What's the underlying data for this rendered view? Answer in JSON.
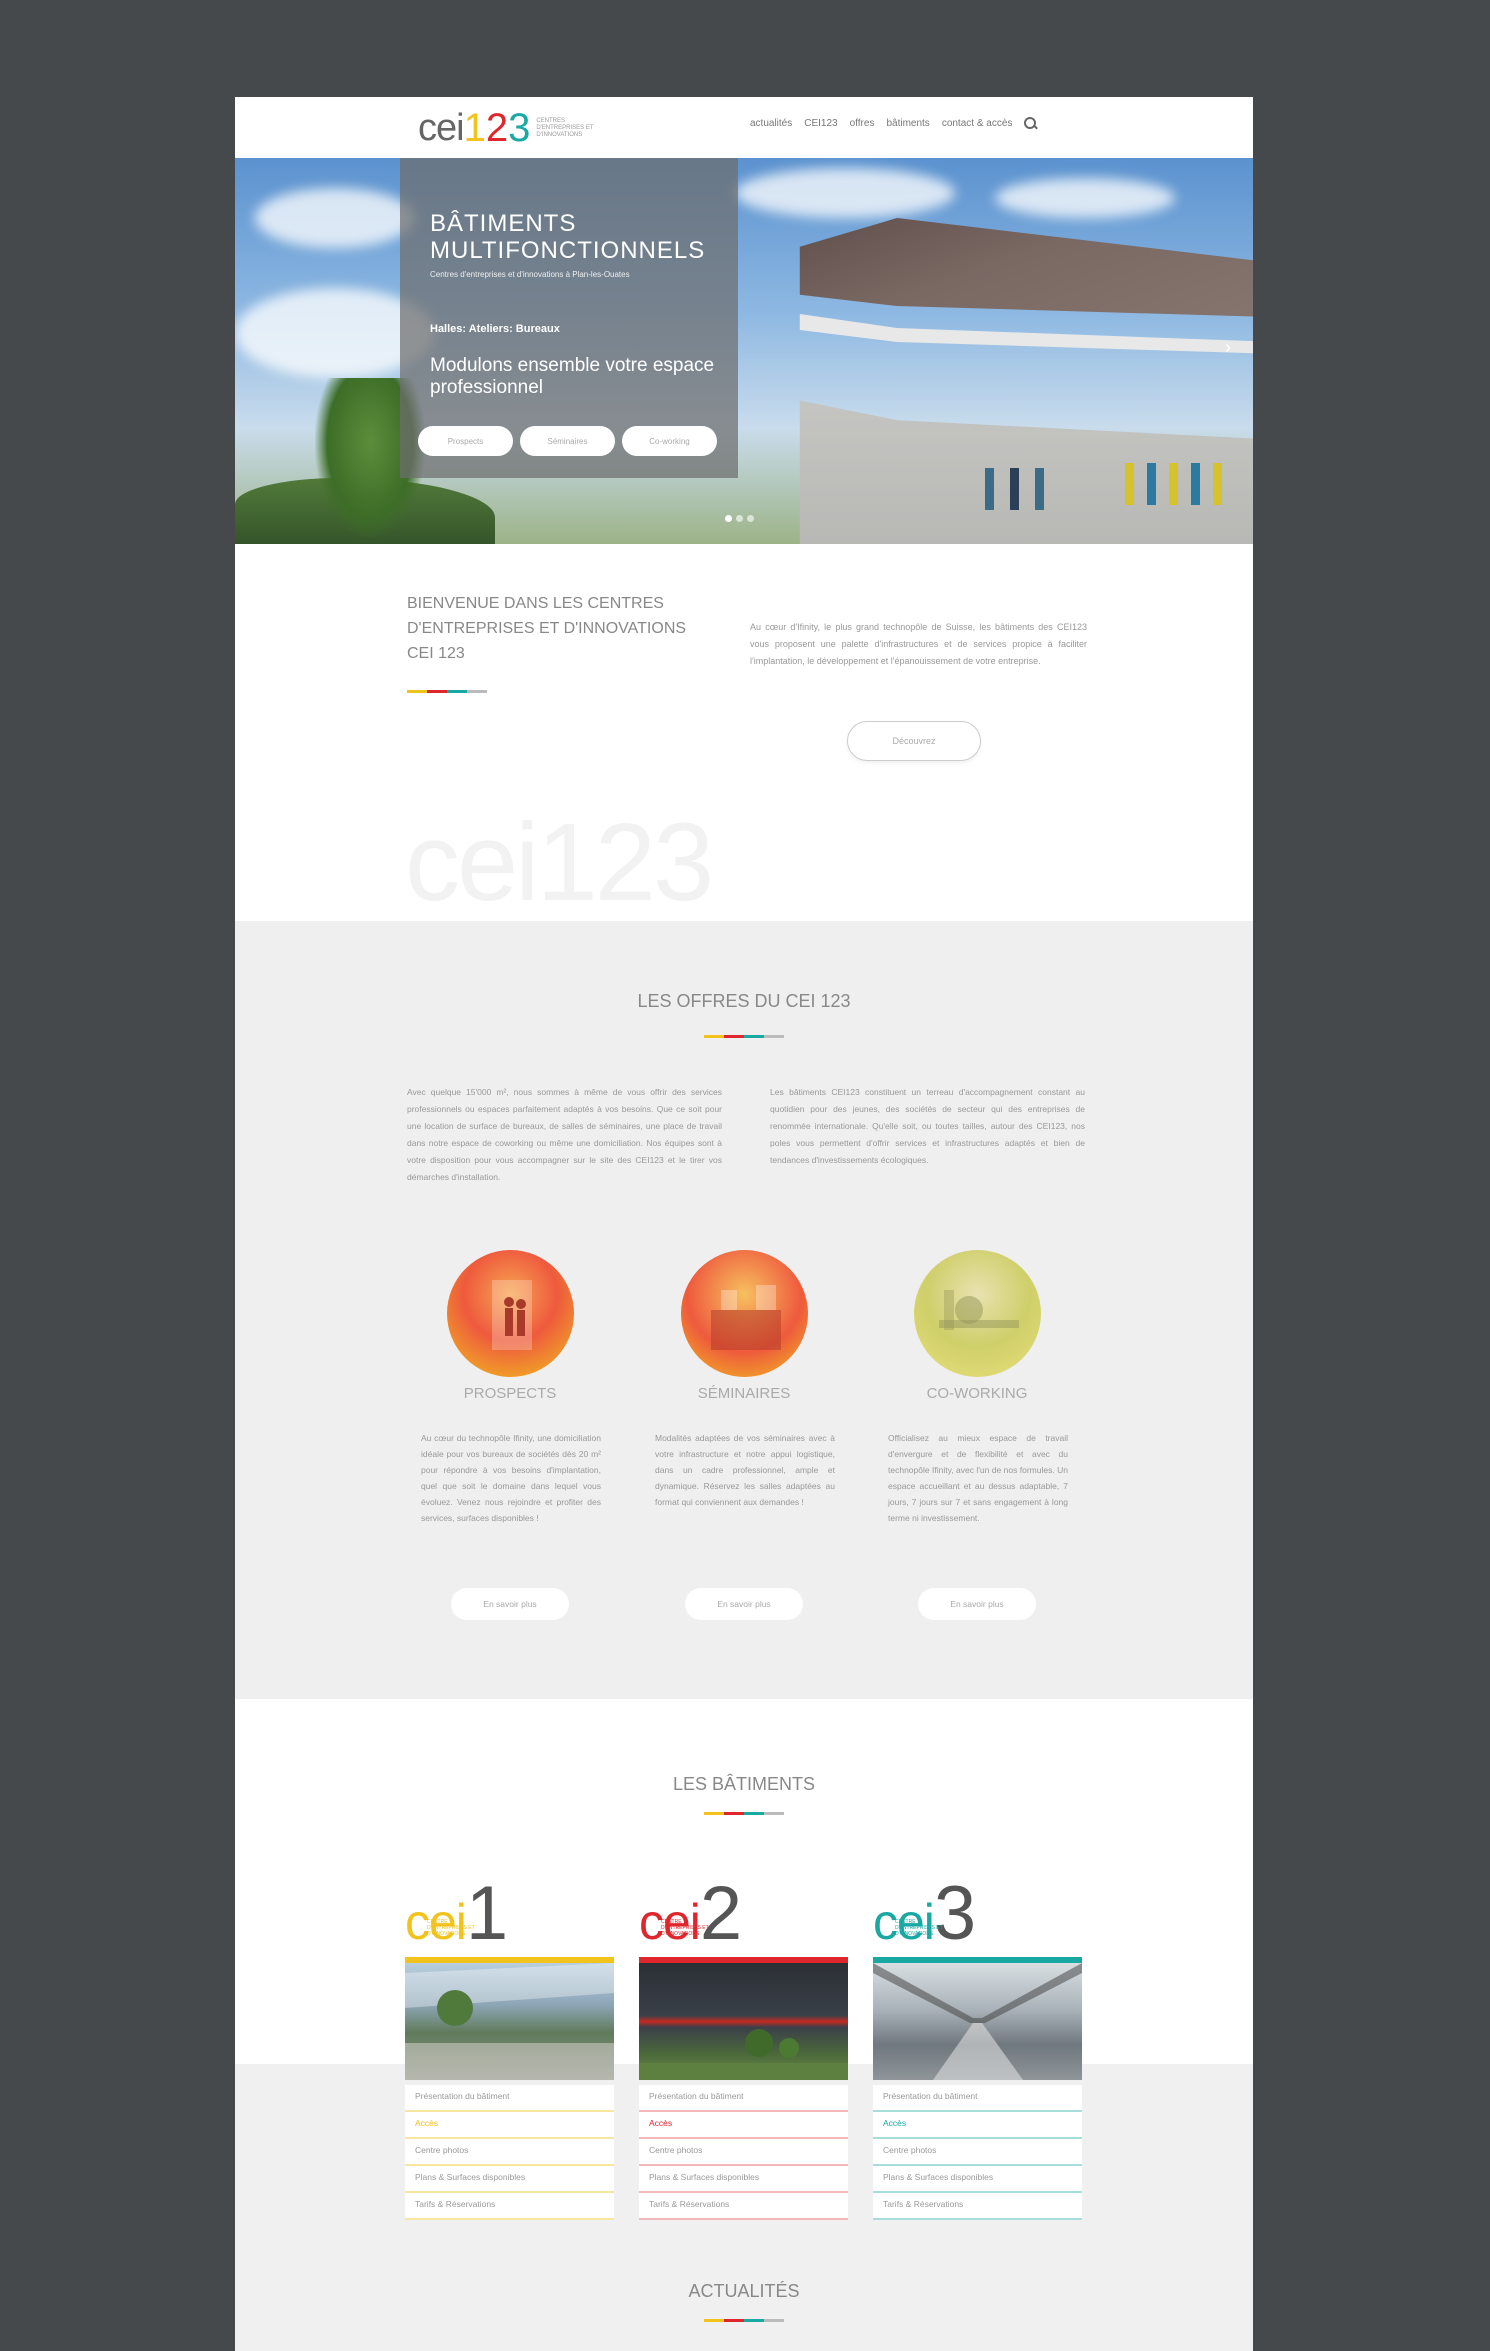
{
  "header": {
    "logo": {
      "word": "cei",
      "digits": [
        "1",
        "2",
        "3"
      ],
      "tagline": "Centres d'entreprises et d'innovations"
    },
    "nav": [
      "actualités",
      "CEI123",
      "offres",
      "bâtiments",
      "contact & accès"
    ]
  },
  "hero": {
    "title": "Bâtiments multifonctionnels",
    "subtitle": "Centres d'entreprises et d'innovations à Plan-les-Ouates",
    "tags": "Halles: Ateliers: Bureaux",
    "slogan": "Modulons ensemble votre espace professionnel",
    "buttons": [
      "Prospects",
      "Séminaires",
      "Co-working"
    ],
    "dots": 3,
    "active_dot": 0
  },
  "welcome": {
    "title": "Bienvenue dans les Centres d'Entreprises et d'Innovations CEI 123",
    "text": "Au cœur d'Ifinity, le plus grand technopôle de Suisse, les bâtiments des CEI123 vous proposent une palette d'infrastructures et de services propice à faciliter l'implantation, le développement et l'épanouissement de votre entreprise.",
    "button": "Découvrez",
    "watermark": "cei123"
  },
  "offers": {
    "title": "Les offres du CEI 123",
    "text_left": "Avec quelque 15'000 m², nous sommes à même de vous offrir des services professionnels ou espaces parfaitement adaptés à vos besoins. Que ce soit pour une location de surface de bureaux, de salles de séminaires, une place de travail dans notre espace de coworking ou même une domiciliation. Nos équipes sont à votre disposition pour vous accompagner sur le site des CEI123 et le tirer vos démarches d'installation.",
    "text_right": "Les bâtiments CEI123 constituent un terreau d'accompagnement constant au quotidien pour des jeunes, des sociétés de secteur qui des entreprises de renommée internationale. Qu'elle soit, ou toutes tailles, autour des CEI123, nos poles vous permettent d'offrir services et infrastructures adaptés et bien de tendances d'investissements écologiques.",
    "items": [
      {
        "title": "Prospects",
        "text": "Au cœur du technopôle Ifinity, une domiciliation idéale pour vos bureaux de sociétés dès 20 m² pour répondre à vos besoins d'implantation, quel que soit le domaine dans lequel vous évoluez. Venez nous rejoindre et profiter des services, surfaces disponibles !",
        "button": "En savoir plus",
        "accent": "#e8442e"
      },
      {
        "title": "Séminaires",
        "text": "Modalités adaptées de vos séminaires avec à votre infrastructure et notre appui logistique, dans un cadre professionnel, ample et dynamique. Réservez les salles adaptées au format qui conviennent aux demandes !",
        "button": "En savoir plus",
        "accent": "#e8442e"
      },
      {
        "title": "Co-working",
        "text": "Officialisez au mieux espace de travail d'envergure et de flexibilité et avec du technopôle Ifinity, avec l'un de nos formules. Un espace accueillant et au dessus adaptable, 7 jours, 7 jours sur 7 et sans engagement à long terme ni investissement.",
        "button": "En savoir plus",
        "accent": "#c9d43a"
      }
    ]
  },
  "buildings": {
    "title": "Les bâtiments",
    "items": [
      {
        "word": "cei",
        "number": "1",
        "color": "#f2c21d",
        "tagline": "Centre d'entreprises et d'innovations",
        "menu": [
          "Présentation du bâtiment",
          "Accès",
          "Centre photos",
          "Plans & Surfaces disponibles",
          "Tarifs & Réservations"
        ]
      },
      {
        "word": "cei",
        "number": "2",
        "color": "#e0262d",
        "tagline": "Centre d'entreprises et d'innovations",
        "menu": [
          "Présentation du bâtiment",
          "Accès",
          "Centre photos",
          "Plans & Surfaces disponibles",
          "Tarifs & Réservations"
        ]
      },
      {
        "word": "cei",
        "number": "3",
        "color": "#1aa8a3",
        "tagline": "Centre d'entreprises et d'innovations",
        "menu": [
          "Présentation du bâtiment",
          "Accès",
          "Centre photos",
          "Plans & Surfaces disponibles",
          "Tarifs & Réservations"
        ]
      }
    ]
  },
  "news": {
    "title": "Actualités"
  },
  "colors": {
    "yellow": "#f2c21d",
    "red": "#e0262d",
    "teal": "#1aa8a3",
    "background": "#45494c"
  }
}
